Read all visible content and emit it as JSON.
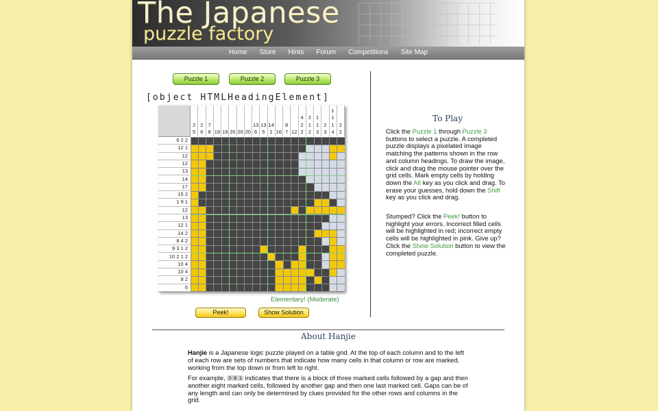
{
  "banner": {
    "title_line1": "The Japanese",
    "title_line2": "puzzle factory"
  },
  "nav": {
    "items": [
      "Home",
      "Store",
      "Hints",
      "Forum",
      "Competitions",
      "Site Map"
    ]
  },
  "puzzle_buttons": [
    "Puzzle 1",
    "Puzzle 2",
    "Puzzle 3"
  ],
  "heading_text": "[object HTMLHeadingElement]",
  "grid": {
    "columns": 20,
    "rows": 20,
    "col_clues": [
      [
        "2",
        "5"
      ],
      [
        "2",
        "6"
      ],
      [
        "7",
        "8"
      ],
      [
        "19"
      ],
      [
        "19"
      ],
      [
        "20"
      ],
      [
        "20"
      ],
      [
        "20"
      ],
      [
        "13",
        "6"
      ],
      [
        "13",
        "5"
      ],
      [
        "14",
        "1"
      ],
      [
        "16"
      ],
      [
        "8",
        "7"
      ],
      [
        "12"
      ],
      [
        "4",
        "2",
        "2"
      ],
      [
        "2",
        "1",
        "2"
      ],
      [
        "1",
        "1",
        "3"
      ],
      [
        "2",
        "3"
      ],
      [
        "1",
        "1",
        "1",
        "4"
      ],
      [
        "2",
        "2"
      ]
    ],
    "row_clues": [
      "6 2 2",
      "12 1",
      "12",
      "12",
      "13",
      "14",
      "17",
      "15 2",
      "1 9 1",
      "12",
      "13",
      "12 1",
      "14 2",
      "8 4 2",
      "9 3 1 2",
      "10 2 1 2",
      "10 4",
      "10 4",
      "8 2",
      "6"
    ],
    "cells": [
      "DDDDDDDDDDDDDDDDDDDD",
      "YYYDDDDDDDDDDDDLLLYY",
      "YYYDDDDDDDDDDDLLLLYL",
      "YYDDDDDDDDDDDDLLLLLL",
      "YYDDDDDDDDDDDDLLLLLL",
      "YYDDDDDDDDDDDDDLLLLL",
      "YYDDDDDDDDDDDDDDLLLL",
      "YDDDDDDDDDDDDDDDDDLL",
      "YDDDDDDDDDDDDDDDYYDL",
      "YYDDDDDDDDDDDYDYYYYY",
      "YYDDDDDDDDDDDDDDDDLL",
      "YYDDDDDDDDDDDDDDDLLL",
      "YYDDDDDDDDDDDDDDYYYL",
      "YYDDDDDDDDDDDDDDDLYL",
      "YYDDDDDDDYDDDDYDDDYY",
      "YYDDDDDDDDYDDDYDDLYY",
      "YYDDDDDDDDDYDYYDDLYY",
      "YYDDDDDDDDDYYYYYDDYL",
      "YYDDDDDDDDDYYYYDYDLL",
      "YYDDDDDDDDDYYYYDDDLL"
    ]
  },
  "difficulty": "Elementary! (Moderate)",
  "action_buttons": {
    "peek": "Peek!",
    "solution": "Show Solution"
  },
  "to_play": {
    "title": "To Play",
    "p1_a": "Click the ",
    "p1_link1": "Puzzle 1",
    "p1_b": " through ",
    "p1_link2": "Puzzle 3",
    "p1_c": " buttons to select a puzzle. A completed puzzle displays a pixelated image matching the patterns shown in the row and column headings. To draw the image, click and drag the mouse pointer over the grid cells. Mark empty cells by holding down the ",
    "p1_alt": "Alt",
    "p1_d": " key as you click and drag. To erase your guesses, hold down the ",
    "p1_shift": "Shift",
    "p1_e": " key as you click and drag.",
    "p2_a": "Stumped? Click the ",
    "p2_peek": "Peek!",
    "p2_b": " button to highlight your errors. Incorrect filled cells will be highlighted in red; incorrect empty cells will be highlighted in pink. Give up? Click the ",
    "p2_show": "Show Solution",
    "p2_c": " button to view the completed puzzle."
  },
  "about": {
    "title": "About Hanjie",
    "p1_bold": "Hanjie",
    "p1_rest": " is a Japanese logic puzzle played on a table grid. At the top of each column and to the left of each row are sets of numbers that indicate how many cells in that column or row are marked, working from the top down or from left to right.",
    "p2_a": "For example, ",
    "p2_code": "3 8 1",
    "p2_b": " indicates that there is a block of three marked cells followed by a gap and then another eight marked cells, followed by another gap and then one last marked cell. Gaps can be of any length and can only be determined by clues provided for the other rows and columns in the grid."
  }
}
